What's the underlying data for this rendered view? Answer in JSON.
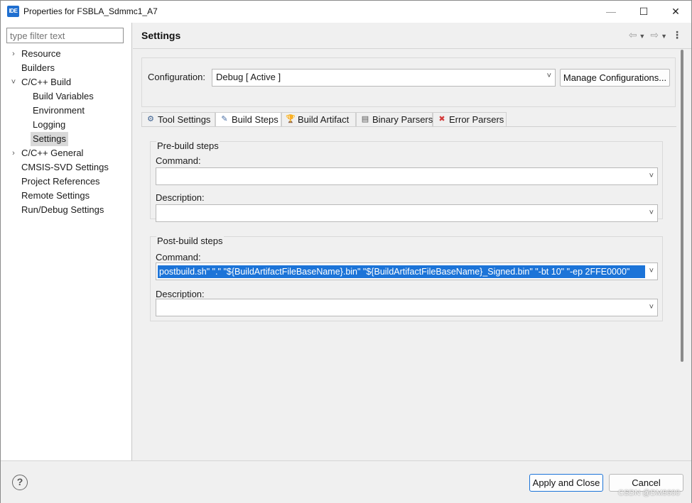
{
  "window": {
    "app_icon_text": "IDE",
    "title": "Properties for FSBLA_Sdmmc1_A7",
    "minimize": "—",
    "maximize": "☐",
    "close": "✕"
  },
  "filter": {
    "placeholder": "type filter text"
  },
  "tree": [
    {
      "label": "Resource",
      "level": 0,
      "chevron": "›"
    },
    {
      "label": "Builders",
      "level": 0,
      "chevron": ""
    },
    {
      "label": "C/C++ Build",
      "level": 0,
      "chevron": "˅"
    },
    {
      "label": "Build Variables",
      "level": 1
    },
    {
      "label": "Environment",
      "level": 1
    },
    {
      "label": "Logging",
      "level": 1
    },
    {
      "label": "Settings",
      "level": 1,
      "selected": true
    },
    {
      "label": "C/C++ General",
      "level": 0,
      "chevron": "›"
    },
    {
      "label": "CMSIS-SVD Settings",
      "level": 0,
      "chevron": ""
    },
    {
      "label": "Project References",
      "level": 0,
      "chevron": ""
    },
    {
      "label": "Remote Settings",
      "level": 0,
      "chevron": ""
    },
    {
      "label": "Run/Debug Settings",
      "level": 0,
      "chevron": ""
    }
  ],
  "header": {
    "title": "Settings",
    "back_icon": "⇦",
    "forward_icon": "⇨",
    "dropdown_icon": "▼",
    "menu_icon": "⋮"
  },
  "configuration": {
    "label": "Configuration:",
    "value": "Debug  [ Active ]",
    "manage_label": "Manage Configurations..."
  },
  "tabs": [
    {
      "label": "Tool Settings",
      "icon": "tool-settings-icon",
      "glyph": "⚙",
      "color": "#3a5f8f"
    },
    {
      "label": "Build Steps",
      "icon": "build-steps-icon",
      "glyph": "✎",
      "color": "#4a6fa5",
      "active": true
    },
    {
      "label": "Build Artifact",
      "icon": "trophy-icon",
      "glyph": "🏆",
      "color": "#d9a400"
    },
    {
      "label": "Binary Parsers",
      "icon": "binary-icon",
      "glyph": "▤",
      "color": "#555555"
    },
    {
      "label": "Error Parsers",
      "icon": "error-icon",
      "glyph": "✖",
      "color": "#d33b3b"
    }
  ],
  "prebuild": {
    "title": "Pre-build steps",
    "command_label": "Command:",
    "command_value": "",
    "description_label": "Description:",
    "description_value": ""
  },
  "postbuild": {
    "title": "Post-build steps",
    "command_label": "Command:",
    "command_value": "postbuild.sh\" \".\" \"${BuildArtifactFileBaseName}.bin\" \"${BuildArtifactFileBaseName}_Signed.bin\" \"-bt 10\" \"-ep 2FFE0000\"",
    "description_label": "Description:",
    "description_value": ""
  },
  "footer": {
    "help": "?",
    "apply_label": "Apply and Close",
    "cancel_label": "Cancel"
  },
  "watermark": "CSDN @DM9600"
}
